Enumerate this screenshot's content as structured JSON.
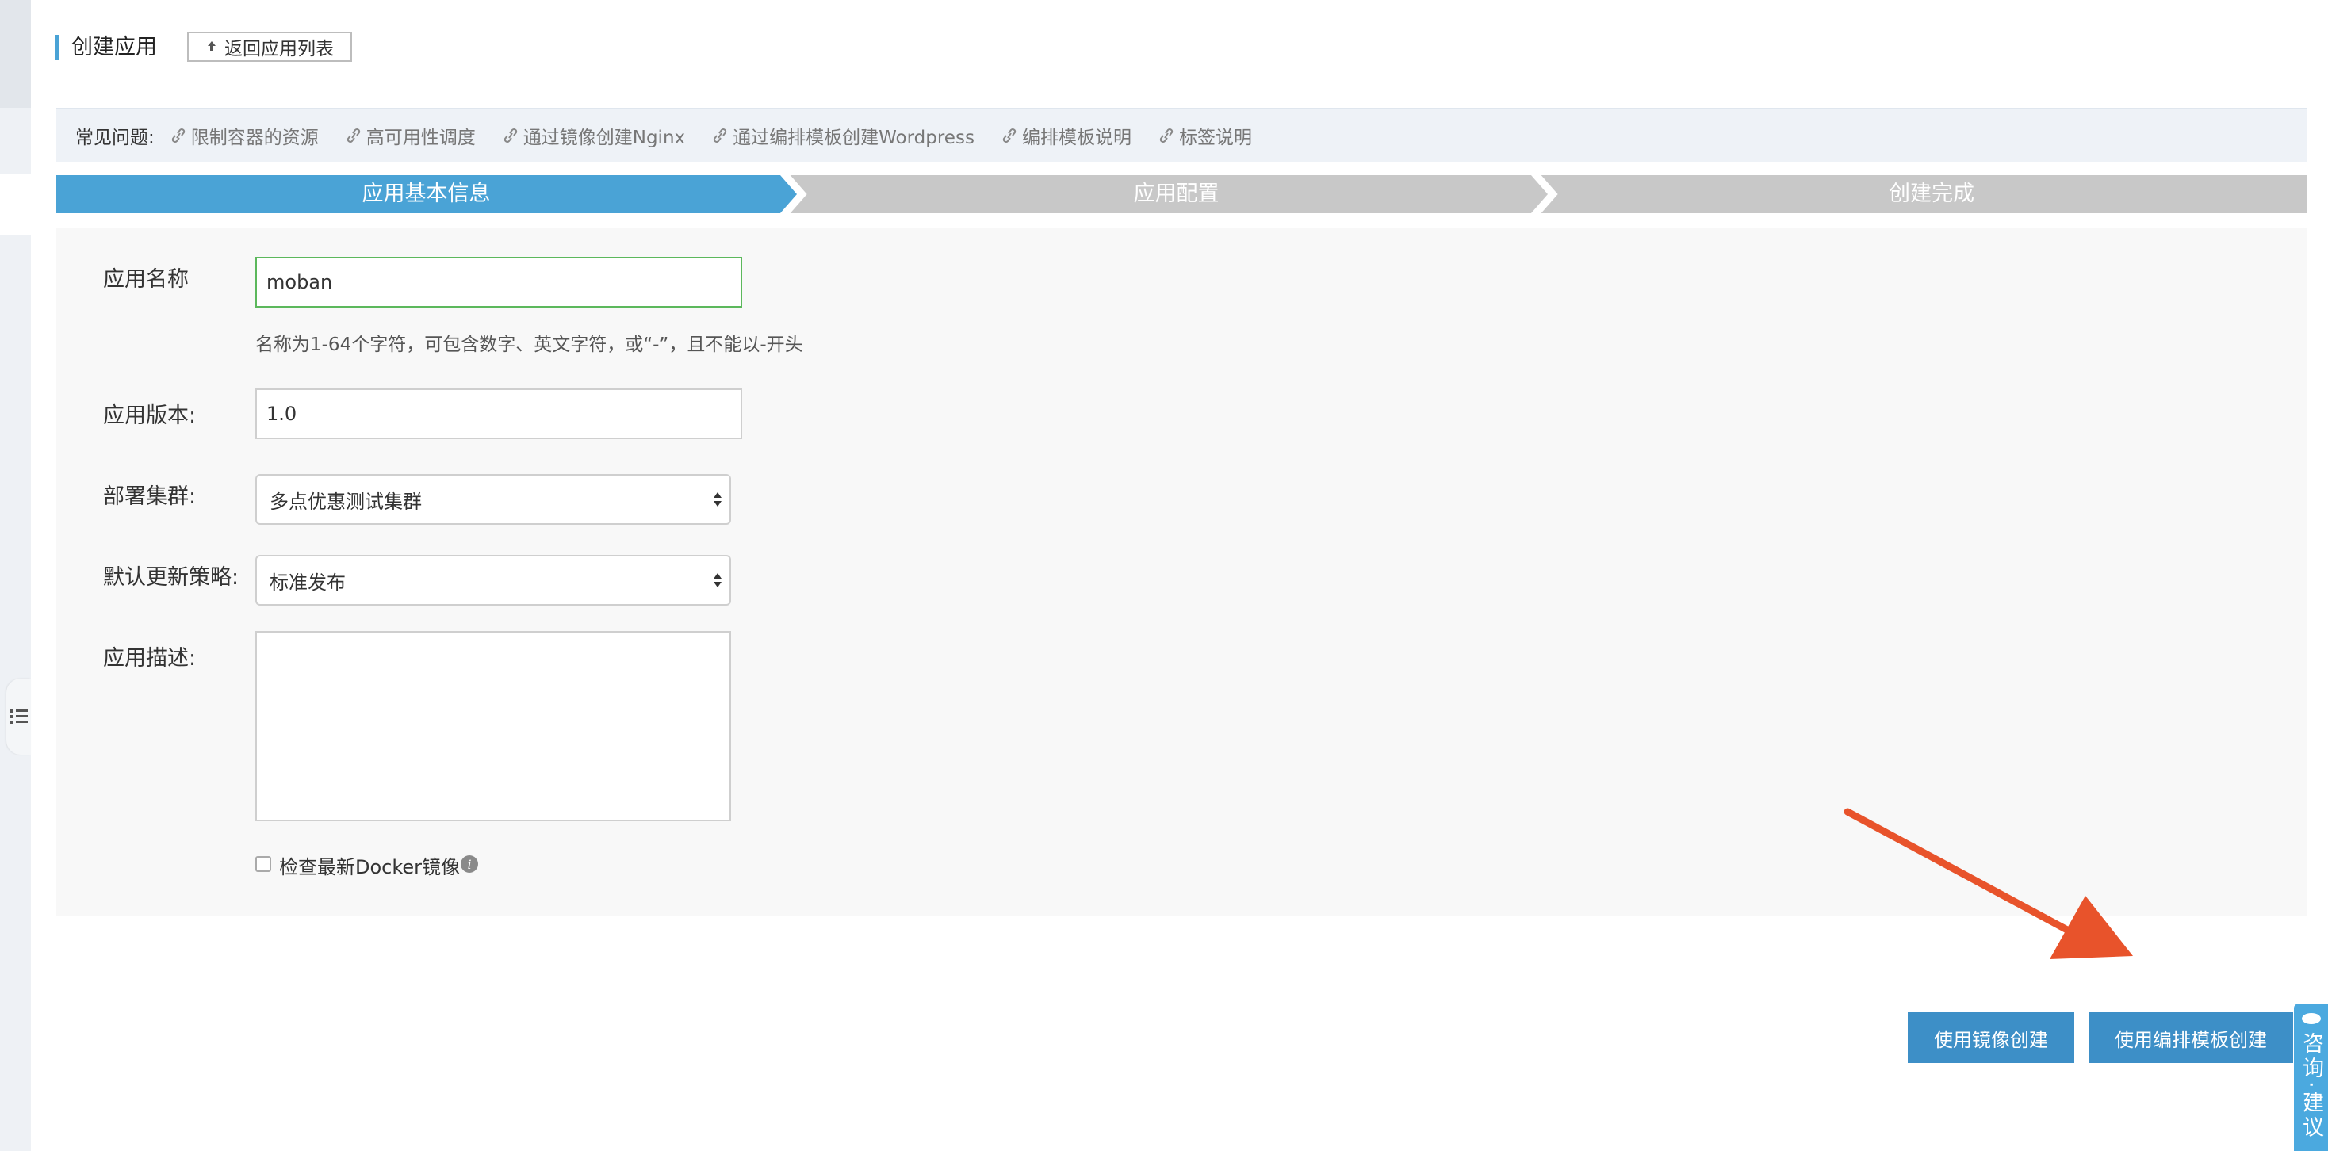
{
  "header": {
    "title": "创建应用",
    "back_label": "返回应用列表"
  },
  "faq": {
    "label": "常见问题:",
    "links": [
      "限制容器的资源",
      "高可用性调度",
      "通过镜像创建Nginx",
      "通过编排模板创建Wordpress",
      "编排模板说明",
      "标签说明"
    ]
  },
  "steps": [
    {
      "label": "应用基本信息",
      "active": true
    },
    {
      "label": "应用配置",
      "active": false
    },
    {
      "label": "创建完成",
      "active": false
    }
  ],
  "form": {
    "name_label": "应用名称",
    "name_value": "moban",
    "name_hint": "名称为1-64个字符，可包含数字、英文字符，或“-”，且不能以-开头",
    "version_label": "应用版本:",
    "version_value": "1.0",
    "cluster_label": "部署集群:",
    "cluster_value": "多点优惠测试集群",
    "strategy_label": "默认更新策略:",
    "strategy_value": "标准发布",
    "desc_label": "应用描述:",
    "desc_value": "",
    "docker_check_label": "检查最新Docker镜像",
    "docker_check_checked": false
  },
  "actions": {
    "image_create": "使用镜像创建",
    "template_create": "使用编排模板创建"
  },
  "feedback": {
    "label": "咨询·建议"
  },
  "colors": {
    "accent": "#4aa3d6",
    "step_active": "#4aa3d6",
    "step_inactive": "#c8c8c8",
    "button": "#3d8fc7",
    "annotation_arrow": "#e8532b",
    "input_focus": "#5cb85c"
  }
}
